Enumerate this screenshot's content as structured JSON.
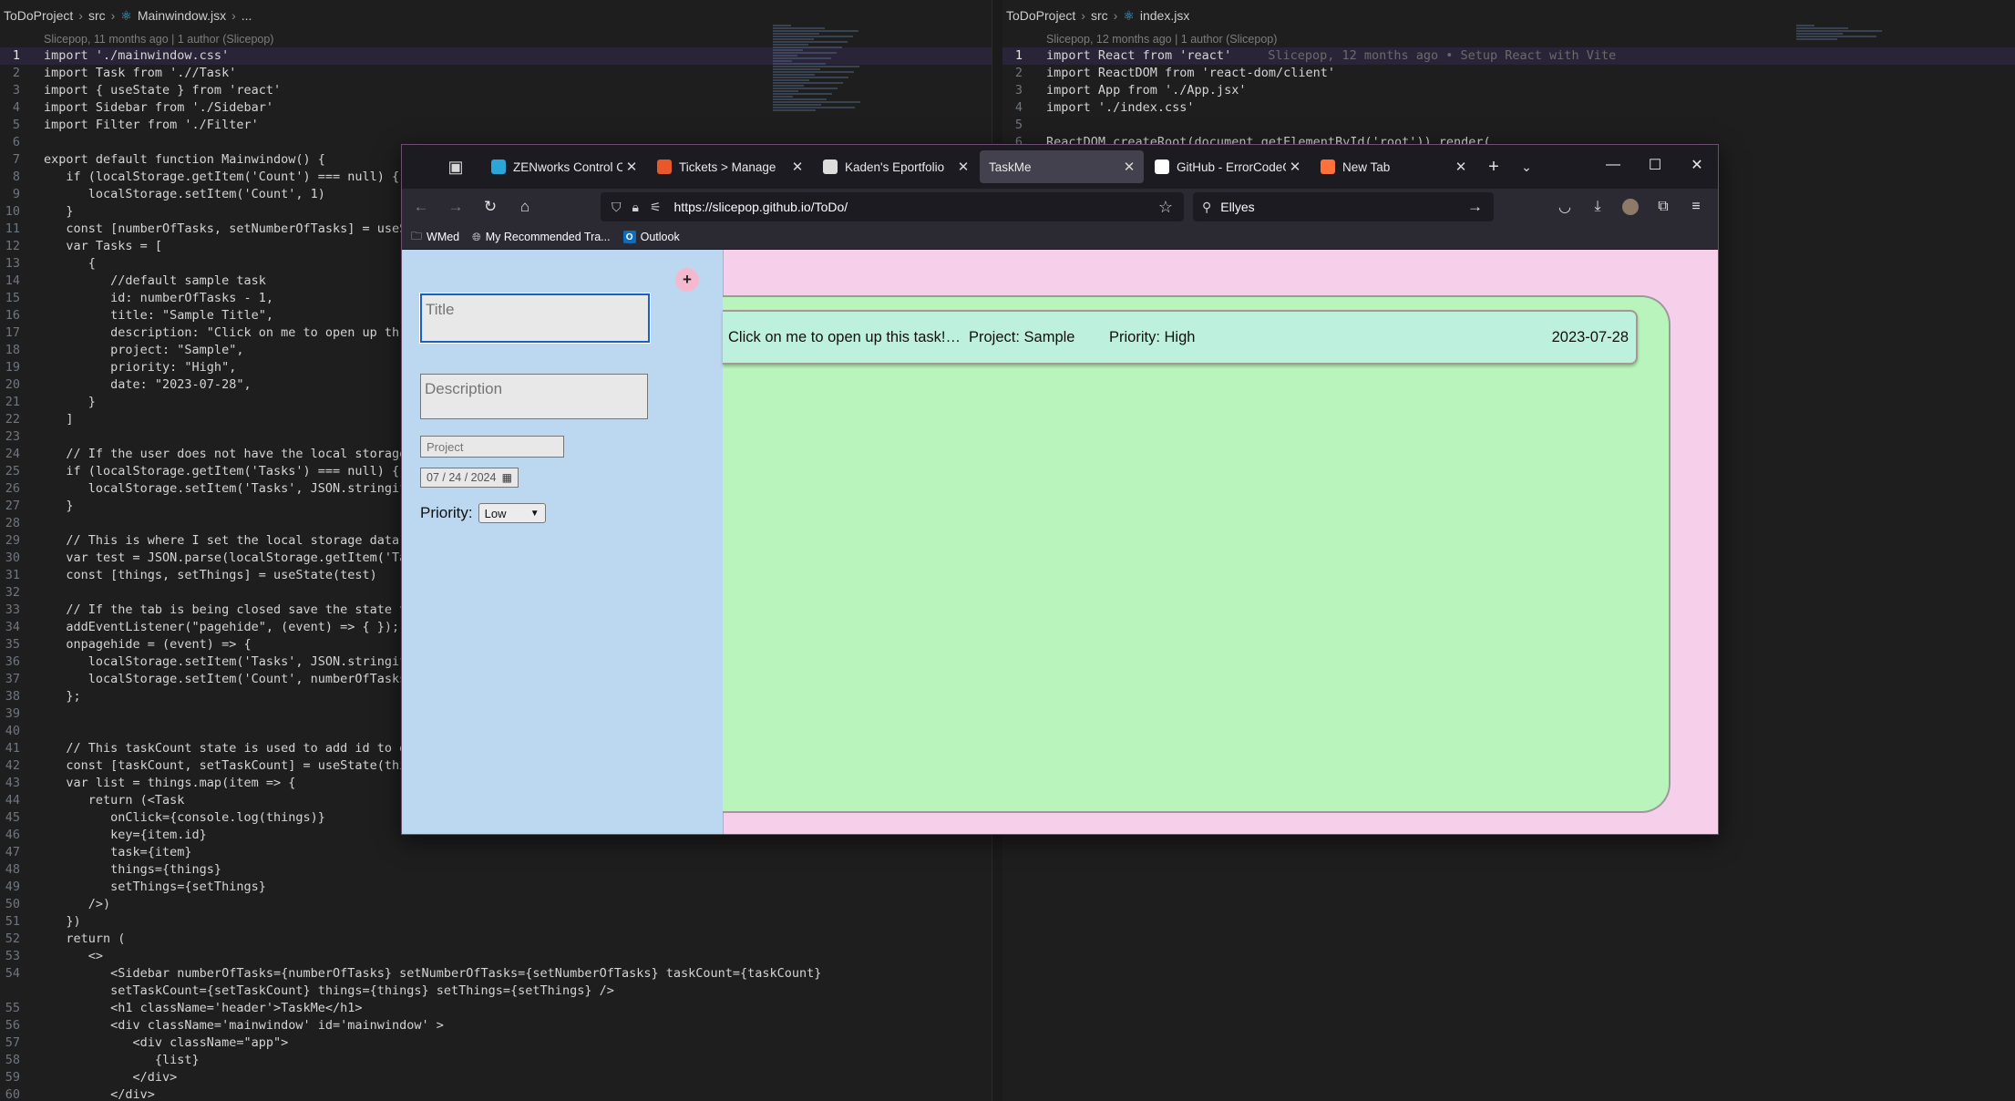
{
  "left_editor": {
    "breadcrumb": [
      "ToDoProject",
      "src",
      "Mainwindow.jsx",
      "..."
    ],
    "blame": "Slicepop, 11 months ago | 1 author (Slicepop)",
    "lines": [
      {
        "n": "1",
        "t": "import './mainwindow.css'"
      },
      {
        "n": "2",
        "t": "import Task from './/Task'"
      },
      {
        "n": "3",
        "t": "import { useState } from 'react'"
      },
      {
        "n": "4",
        "t": "import Sidebar from './Sidebar'"
      },
      {
        "n": "5",
        "t": "import Filter from './Filter'"
      },
      {
        "n": "6",
        "t": ""
      },
      {
        "n": "7",
        "t": "export default function Mainwindow() {"
      },
      {
        "n": "8",
        "t": "   if (localStorage.getItem('Count') === null) {"
      },
      {
        "n": "9",
        "t": "      localStorage.setItem('Count', 1)"
      },
      {
        "n": "10",
        "t": "   }"
      },
      {
        "n": "11",
        "t": "   const [numberOfTasks, setNumberOfTasks] = useSt"
      },
      {
        "n": "12",
        "t": "   var Tasks = ["
      },
      {
        "n": "13",
        "t": "      {"
      },
      {
        "n": "14",
        "t": "         //default sample task"
      },
      {
        "n": "15",
        "t": "         id: numberOfTasks - 1,"
      },
      {
        "n": "16",
        "t": "         title: \"Sample Title\","
      },
      {
        "n": "17",
        "t": "         description: \"Click on me to open up th"
      },
      {
        "n": "18",
        "t": "         project: \"Sample\","
      },
      {
        "n": "19",
        "t": "         priority: \"High\","
      },
      {
        "n": "20",
        "t": "         date: \"2023-07-28\","
      },
      {
        "n": "21",
        "t": "      }"
      },
      {
        "n": "22",
        "t": "   ]"
      },
      {
        "n": "23",
        "t": ""
      },
      {
        "n": "24",
        "t": "   // If the user does not have the local storage"
      },
      {
        "n": "25",
        "t": "   if (localStorage.getItem('Tasks') === null) {"
      },
      {
        "n": "26",
        "t": "      localStorage.setItem('Tasks', JSON.stringif"
      },
      {
        "n": "27",
        "t": "   }"
      },
      {
        "n": "28",
        "t": ""
      },
      {
        "n": "29",
        "t": "   // This is where I set the local storage data t"
      },
      {
        "n": "30",
        "t": "   var test = JSON.parse(localStorage.getItem('Tas"
      },
      {
        "n": "31",
        "t": "   const [things, setThings] = useState(test)"
      },
      {
        "n": "32",
        "t": ""
      },
      {
        "n": "33",
        "t": "   // If the tab is being closed save the state th"
      },
      {
        "n": "34",
        "t": "   addEventListener(\"pagehide\", (event) => { });"
      },
      {
        "n": "35",
        "t": "   onpagehide = (event) => {"
      },
      {
        "n": "36",
        "t": "      localStorage.setItem('Tasks', JSON.stringif"
      },
      {
        "n": "37",
        "t": "      localStorage.setItem('Count', numberOfTasks"
      },
      {
        "n": "38",
        "t": "   };"
      },
      {
        "n": "39",
        "t": ""
      },
      {
        "n": "40",
        "t": ""
      },
      {
        "n": "41",
        "t": "   // This taskCount state is used to add id to ea"
      },
      {
        "n": "42",
        "t": "   const [taskCount, setTaskCount] = useState(thir"
      },
      {
        "n": "43",
        "t": "   var list = things.map(item => {"
      },
      {
        "n": "44",
        "t": "      return (<Task"
      },
      {
        "n": "45",
        "t": "         onClick={console.log(things)}"
      },
      {
        "n": "46",
        "t": "         key={item.id}"
      },
      {
        "n": "47",
        "t": "         task={item}"
      },
      {
        "n": "48",
        "t": "         things={things}"
      },
      {
        "n": "49",
        "t": "         setThings={setThings}"
      },
      {
        "n": "50",
        "t": "      />)"
      },
      {
        "n": "51",
        "t": "   })"
      },
      {
        "n": "52",
        "t": "   return ("
      },
      {
        "n": "53",
        "t": "      <>"
      },
      {
        "n": "54",
        "t": "         <Sidebar numberOfTasks={numberOfTasks} setNumberOfTasks={setNumberOfTasks} taskCount={taskCount}"
      },
      {
        "n": "",
        "t": "         setTaskCount={setTaskCount} things={things} setThings={setThings} />"
      },
      {
        "n": "55",
        "t": "         <h1 className='header'>TaskMe</h1>"
      },
      {
        "n": "56",
        "t": "         <div className='mainwindow' id='mainwindow' >"
      },
      {
        "n": "57",
        "t": "            <div className=\"app\">"
      },
      {
        "n": "58",
        "t": "               {list}"
      },
      {
        "n": "59",
        "t": "            </div>"
      },
      {
        "n": "60",
        "t": "         </div>"
      }
    ]
  },
  "right_editor": {
    "breadcrumb": [
      "ToDoProject",
      "src",
      "index.jsx"
    ],
    "blame": "Slicepop, 12 months ago | 1 author (Slicepop)",
    "inline_blame": "Slicepop, 12 months ago • Setup React with Vite",
    "lines": [
      {
        "n": "1",
        "t": "import React from 'react'"
      },
      {
        "n": "2",
        "t": "import ReactDOM from 'react-dom/client'"
      },
      {
        "n": "3",
        "t": "import App from './App.jsx'"
      },
      {
        "n": "4",
        "t": "import './index.css'"
      },
      {
        "n": "5",
        "t": ""
      },
      {
        "n": "6",
        "t": "ReactDOM.createRoot(document.getElementById('root')).render("
      }
    ]
  },
  "browser": {
    "tabs": [
      {
        "title": "ZENworks Control Cent",
        "icon": "zenworks-icon",
        "color": "#2aa7d8"
      },
      {
        "title": "Tickets > Manage",
        "icon": "tickets-icon",
        "color": "#e8582a"
      },
      {
        "title": "Kaden's Eportfolio",
        "icon": "portfolio-icon",
        "color": "#dddddd"
      },
      {
        "title": "TaskMe",
        "icon": "",
        "color": ""
      },
      {
        "title": "GitHub - ErrorCodeGam",
        "icon": "github-icon",
        "color": "#ffffff"
      },
      {
        "title": "New Tab",
        "icon": "firefox-icon",
        "color": "#ff7139"
      }
    ],
    "url": "https://slicepop.github.io/ToDo/",
    "search_value": "Ellyes",
    "bookmarks": [
      "WMed",
      "My Recommended Tra...",
      "Outlook"
    ]
  },
  "taskme": {
    "add_label": "+",
    "title_placeholder": "Title",
    "description_placeholder": "Description",
    "project_placeholder": "Project",
    "date_value": "07 / 24 / 2024",
    "priority_label": "Priority:",
    "priority_value": "Low",
    "task": {
      "description": "Click on me to open up this task! Press the edit i...",
      "project": "Project: Sample",
      "priority": "Priority: High",
      "date": "2023-07-28"
    }
  }
}
